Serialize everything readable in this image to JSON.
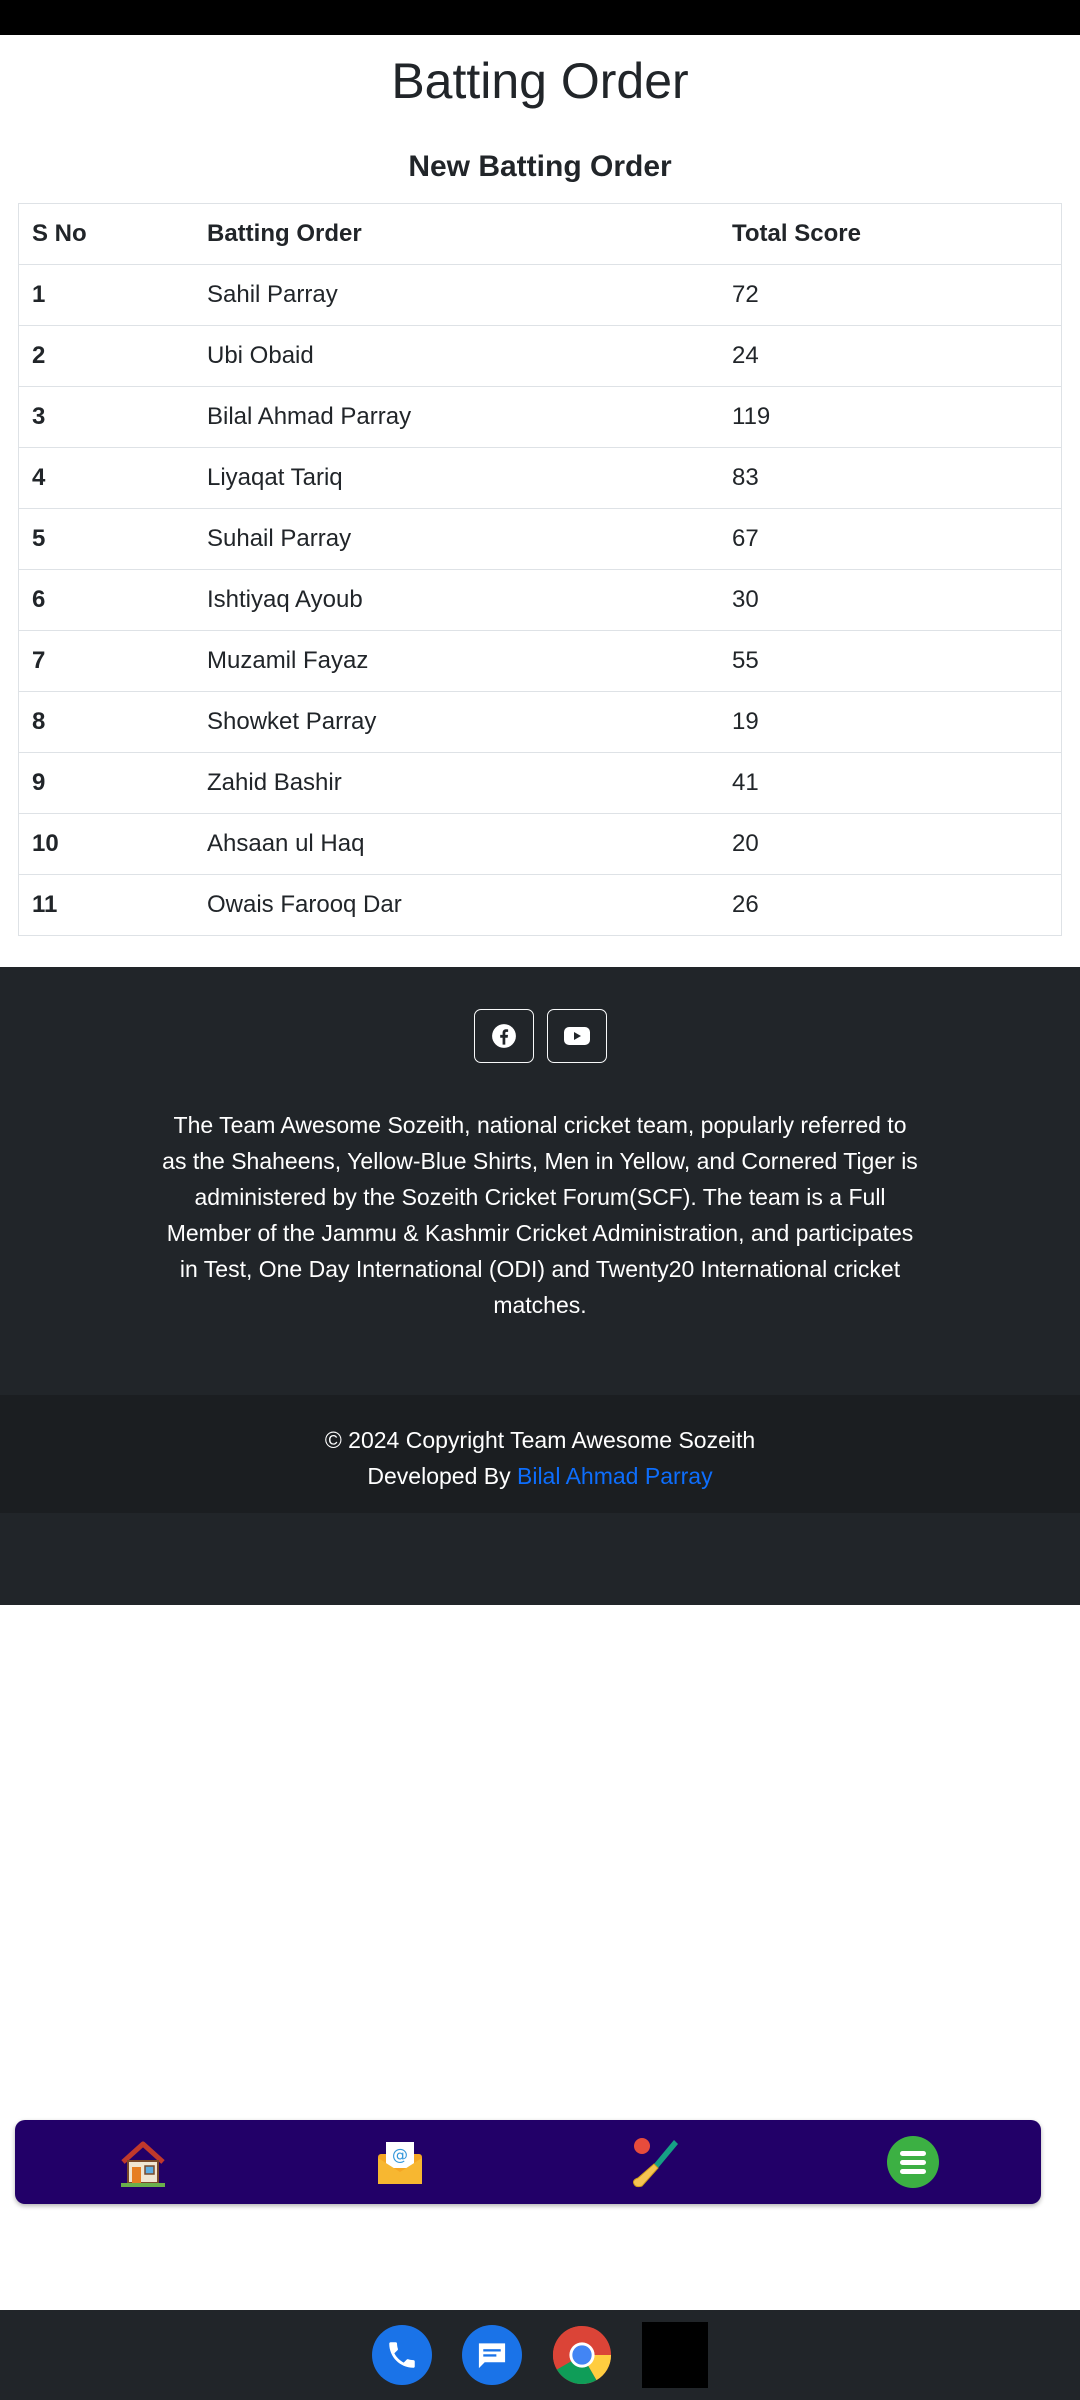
{
  "header": {
    "page_title": "Batting Order",
    "section_title": "New Batting Order"
  },
  "table": {
    "headers": [
      "S No",
      "Batting Order",
      "Total Score"
    ],
    "rows": [
      {
        "sno": "1",
        "name": "Sahil Parray",
        "score": "72"
      },
      {
        "sno": "2",
        "name": "Ubi Obaid",
        "score": "24"
      },
      {
        "sno": "3",
        "name": "Bilal Ahmad Parray",
        "score": "119"
      },
      {
        "sno": "4",
        "name": "Liyaqat Tariq",
        "score": "83"
      },
      {
        "sno": "5",
        "name": "Suhail Parray",
        "score": "67"
      },
      {
        "sno": "6",
        "name": "Ishtiyaq Ayoub",
        "score": "30"
      },
      {
        "sno": "7",
        "name": "Muzamil Fayaz",
        "score": "55"
      },
      {
        "sno": "8",
        "name": "Showket Parray",
        "score": "19"
      },
      {
        "sno": "9",
        "name": "Zahid Bashir",
        "score": "41"
      },
      {
        "sno": "10",
        "name": "Ahsaan ul Haq",
        "score": "20"
      },
      {
        "sno": "11",
        "name": "Owais Farooq Dar",
        "score": "26"
      }
    ]
  },
  "footer": {
    "social_icons": [
      "facebook-icon",
      "youtube-icon"
    ],
    "about": "The Team Awesome Sozeith, national cricket team, popularly referred to as the Shaheens, Yellow-Blue Shirts, Men in Yellow, and Cornered Tiger is administered by the Sozeith Cricket Forum(SCF). The team is a Full Member of the Jammu & Kashmir Cricket Administration, and participates in Test, One Day International (ODI) and Twenty20 International cricket matches.",
    "copyright": "© 2024 Copyright Team Awesome Sozeith",
    "developed_by_prefix": "Developed By ",
    "developer_name": "Bilal Ahmad Parray"
  },
  "bottom_nav": {
    "items": [
      "home-icon",
      "mail-icon",
      "cricket-icon",
      "menu-icon"
    ]
  },
  "colors": {
    "footer_bg": "#212529",
    "copyright_bg": "#1b1e21",
    "link": "#0d6efd",
    "nav_bg": "#220068"
  }
}
